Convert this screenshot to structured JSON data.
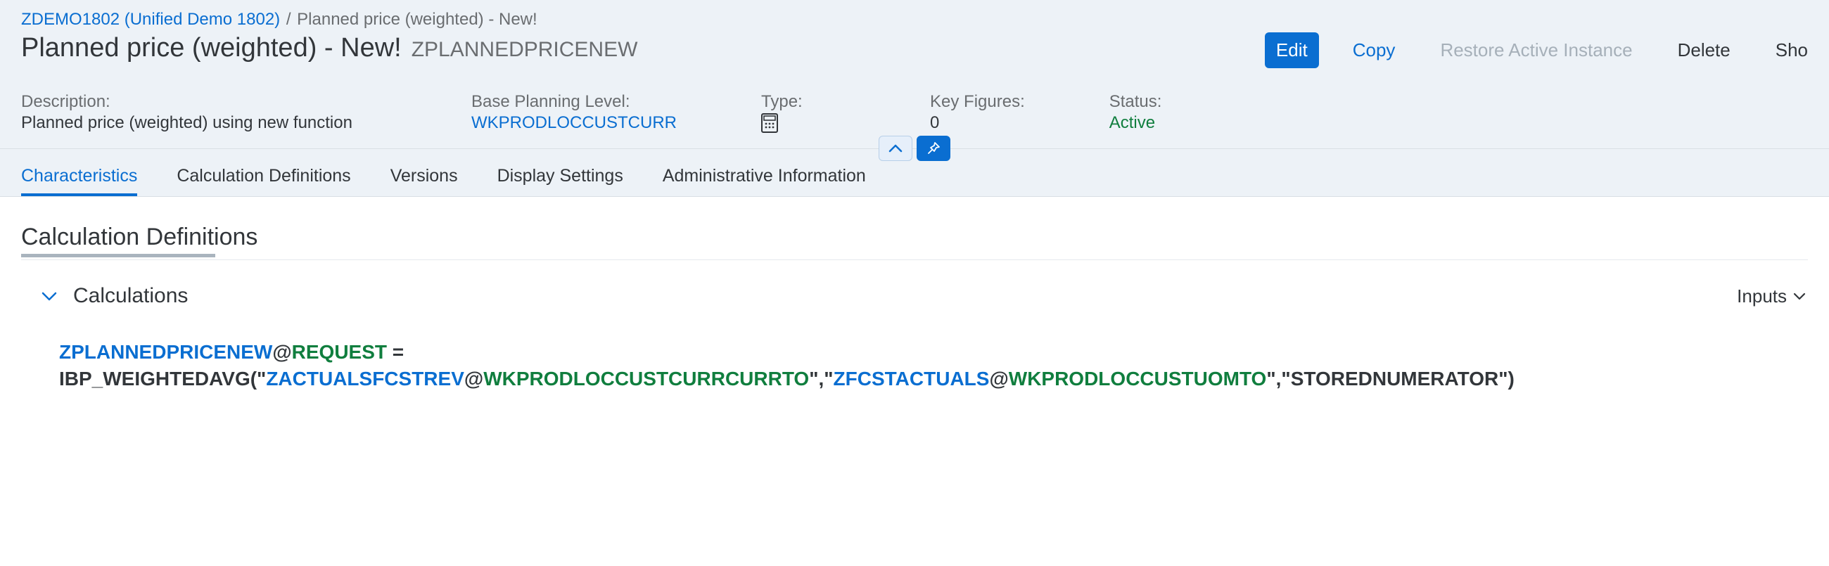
{
  "breadcrumb": {
    "link_text": "ZDEMO1802 (Unified Demo 1802)",
    "current": "Planned price (weighted) - New!"
  },
  "header": {
    "title": "Planned price (weighted) - New!",
    "code": "ZPLANNEDPRICENEW"
  },
  "actions": {
    "edit": "Edit",
    "copy": "Copy",
    "restore": "Restore Active Instance",
    "delete": "Delete",
    "show": "Sho"
  },
  "info": {
    "description_label": "Description:",
    "description_value": "Planned price (weighted) using new function",
    "bpl_label": "Base Planning Level:",
    "bpl_value": "WKPRODLOCCUSTCURR",
    "type_label": "Type:",
    "type_icon": "calculator-icon",
    "kf_label": "Key Figures:",
    "kf_value": "0",
    "status_label": "Status:",
    "status_value": "Active"
  },
  "handle": {
    "collapse_icon": "chevron-up-icon",
    "pin_icon": "pin-icon"
  },
  "tabs": [
    {
      "label": "Characteristics",
      "selected": true
    },
    {
      "label": "Calculation Definitions",
      "selected": false
    },
    {
      "label": "Versions",
      "selected": false
    },
    {
      "label": "Display Settings",
      "selected": false
    },
    {
      "label": "Administrative Information",
      "selected": false
    }
  ],
  "section": {
    "title": "Calculation Definitions",
    "subsection": "Calculations",
    "inputs_btn": "Inputs"
  },
  "formula": {
    "line1": {
      "kf": "ZPLANNEDPRICENEW",
      "at": "@",
      "pl": "REQUEST",
      "eq": " ="
    },
    "line2": {
      "fn_open": "IBP_WEIGHTEDAVG(\"",
      "kf1": "ZACTUALSFCSTREV",
      "at1": "@",
      "pl1": "WKPRODLOCCUSTCURRCURRTO",
      "sep1": "\",\"",
      "kf2": "ZFCSTACTUALS",
      "at2": "@",
      "pl2": "WKPRODLOCCUSTUOMTO",
      "sep2": "\",\"",
      "lit": "STOREDNUMERATOR",
      "close": "\")"
    }
  }
}
